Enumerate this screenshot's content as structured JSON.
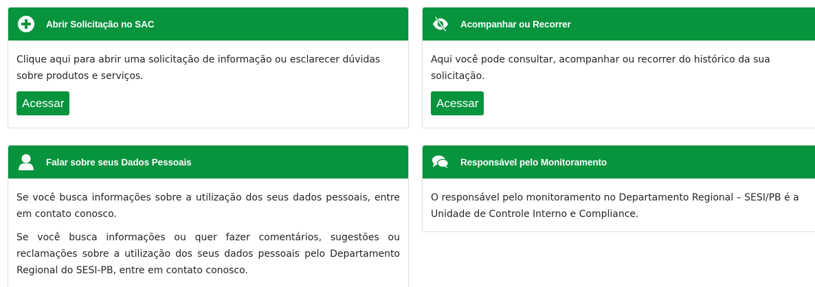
{
  "cards": [
    {
      "title": "Abrir Solicitação no SAC",
      "icon": "plus-circle-icon",
      "paragraphs": [
        "Clique aqui para abrir uma solicitação de informação ou esclarecer dúvidas sobre produtos e serviços."
      ],
      "button_label": "Acessar"
    },
    {
      "title": "Acompanhar ou Recorrer",
      "icon": "eye-slash-icon",
      "paragraphs": [
        "Aqui você pode consultar, acompanhar ou recorrer do histórico da sua solicitação."
      ],
      "button_label": "Acessar"
    },
    {
      "title": "Falar sobre seus Dados Pessoais",
      "icon": "user-icon",
      "paragraphs": [
        "Se você busca informações sobre a utilização dos seus dados pessoais, entre em contato conosco.",
        "Se você busca informações ou quer fazer comentários, sugestões ou reclamações sobre a utilização dos seus dados pessoais pelo Departamento Regional do SESI-PB, entre em contato conosco."
      ]
    },
    {
      "title": "Responsável pelo Monitoramento",
      "icon": "comments-icon",
      "paragraphs": [
        "O responsável pelo monitoramento no Departamento Regional – SESI/PB é a Unidade de Controle Interno e Compliance."
      ]
    }
  ],
  "colors": {
    "accent": "#08933d",
    "text": "#212529",
    "border": "#dcdcdc"
  }
}
